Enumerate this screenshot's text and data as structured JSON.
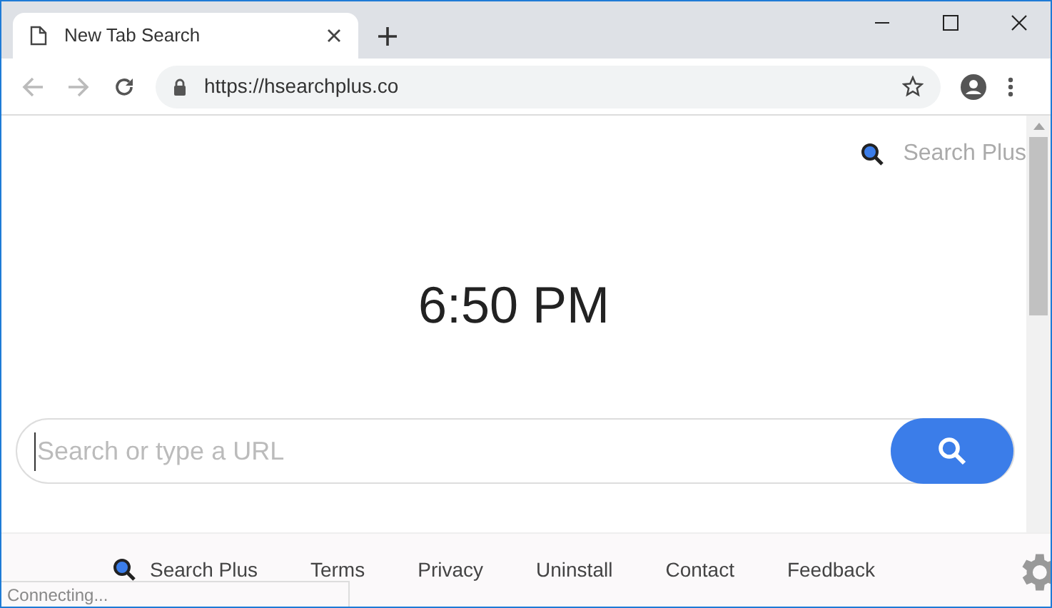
{
  "tab": {
    "title": "New Tab Search",
    "selected": true
  },
  "address_bar": {
    "url": "https://hsearchplus.co"
  },
  "header_link": {
    "label": "Search Plus"
  },
  "clock": {
    "time": "6:50 PM"
  },
  "search": {
    "placeholder": "Search or type a URL"
  },
  "footer_links": [
    {
      "label": "Search Plus",
      "kind": "brand"
    },
    {
      "label": "Terms",
      "kind": "plain"
    },
    {
      "label": "Privacy",
      "kind": "plain"
    },
    {
      "label": "Uninstall",
      "kind": "plain"
    },
    {
      "label": "Contact",
      "kind": "plain"
    },
    {
      "label": "Feedback",
      "kind": "plain"
    }
  ],
  "status_bar": {
    "text": "Connecting..."
  }
}
